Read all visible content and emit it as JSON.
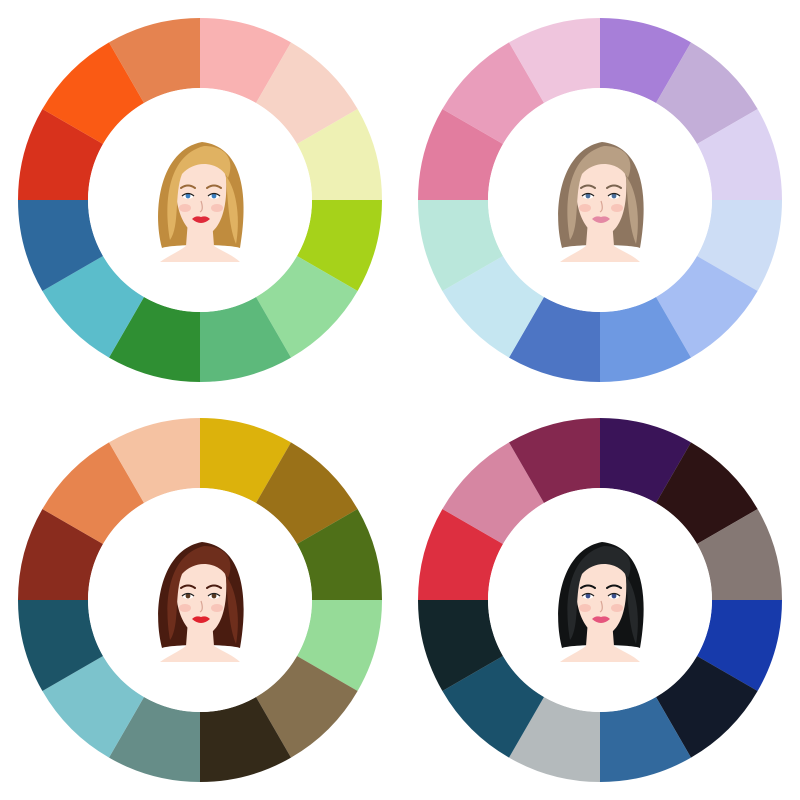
{
  "wheels": [
    {
      "name": "warm-light-wheel",
      "segments": [
        "#F9B2B2",
        "#F7D3C6",
        "#EEF1B4",
        "#A6D21A",
        "#94DC9C",
        "#5DB97B",
        "#2F8F33",
        "#5BBDCB",
        "#2E699D",
        "#D8321C",
        "#FA5A14",
        "#E58350"
      ],
      "portrait": {
        "hair": "#E0B262",
        "hair_shade": "#C08C3E",
        "skin": "#FCE0D2",
        "lips": "#DF2A3A",
        "eyes": "#3A7FC1",
        "brows": "#9A6A3A"
      }
    },
    {
      "name": "cool-light-wheel",
      "segments": [
        "#A77FD8",
        "#C3AED8",
        "#DCD2F2",
        "#CDDDF5",
        "#A6BEF3",
        "#6E99E2",
        "#4D75C4",
        "#C5E6F1",
        "#BAE7DB",
        "#E27D9F",
        "#E99DBB",
        "#EFC5DD"
      ],
      "portrait": {
        "hair": "#B89F84",
        "hair_shade": "#8E7660",
        "skin": "#FCE0D2",
        "lips": "#E488A4",
        "eyes": "#4A6F9E",
        "brows": "#7A6450"
      }
    },
    {
      "name": "warm-deep-wheel",
      "segments": [
        "#DCB20C",
        "#9A7118",
        "#4F7018",
        "#96DB98",
        "#85704F",
        "#342A19",
        "#668D88",
        "#7CC3CC",
        "#1C5467",
        "#8A2C1E",
        "#E7844E",
        "#F5C2A2"
      ],
      "portrait": {
        "hair": "#6E2E1C",
        "hair_shade": "#4A1C10",
        "skin": "#FCE0D2",
        "lips": "#E0232F",
        "eyes": "#5A3A22",
        "brows": "#4A1C10"
      }
    },
    {
      "name": "cool-deep-wheel",
      "segments": [
        "#3A1458",
        "#2D1314",
        "#857874",
        "#173AAB",
        "#121A2A",
        "#32699D",
        "#B4BABC",
        "#1A516B",
        "#13262B",
        "#DD2F40",
        "#D686A2",
        "#84284F"
      ],
      "portrait": {
        "hair": "#25282A",
        "hair_shade": "#111314",
        "skin": "#FCE0D2",
        "lips": "#E5557D",
        "eyes": "#3A4F8E",
        "brows": "#111314"
      }
    }
  ]
}
